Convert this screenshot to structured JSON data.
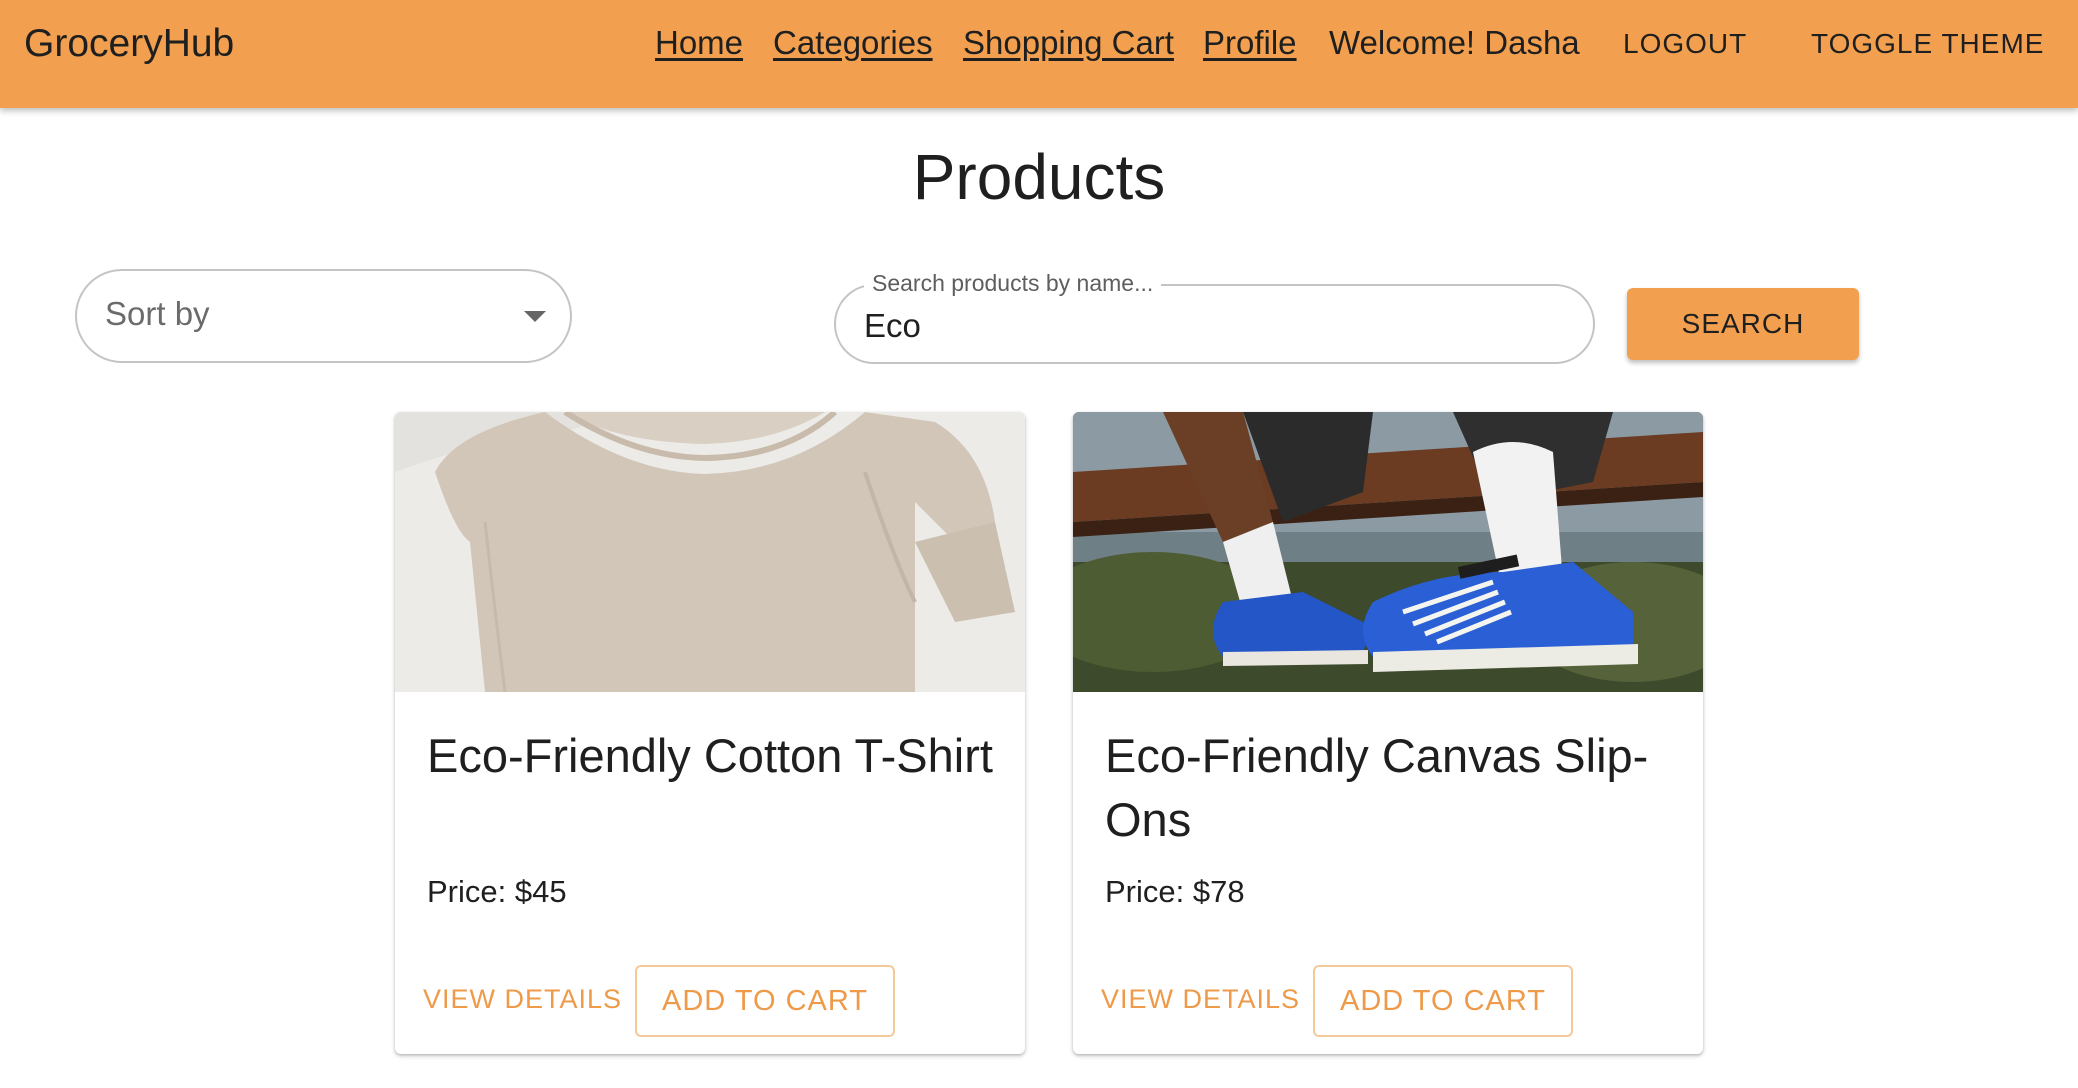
{
  "app": {
    "brand": "GroceryHub",
    "accent_color": "#f2a04f"
  },
  "nav": {
    "home": "Home",
    "categories": "Categories",
    "cart": "Shopping Cart",
    "profile": "Profile",
    "welcome": "Welcome! Dasha",
    "logout": "LOGOUT",
    "toggle_theme": "TOGGLE THEME"
  },
  "page": {
    "title": "Products"
  },
  "filters": {
    "sort_label": "Sort by",
    "search_label": "Search products by name...",
    "search_value": "Eco",
    "search_button": "SEARCH"
  },
  "products": [
    {
      "name": "Eco-Friendly Cotton T-Shirt",
      "price": "Price: $45",
      "image": "beige-tshirt-photo",
      "view_details": "VIEW DETAILS",
      "add_to_cart": "ADD TO CART"
    },
    {
      "name": "Eco-Friendly Canvas Slip-Ons",
      "price": "Price: $78",
      "image": "blue-canvas-sneakers-photo",
      "view_details": "VIEW DETAILS",
      "add_to_cart": "ADD TO CART"
    }
  ]
}
